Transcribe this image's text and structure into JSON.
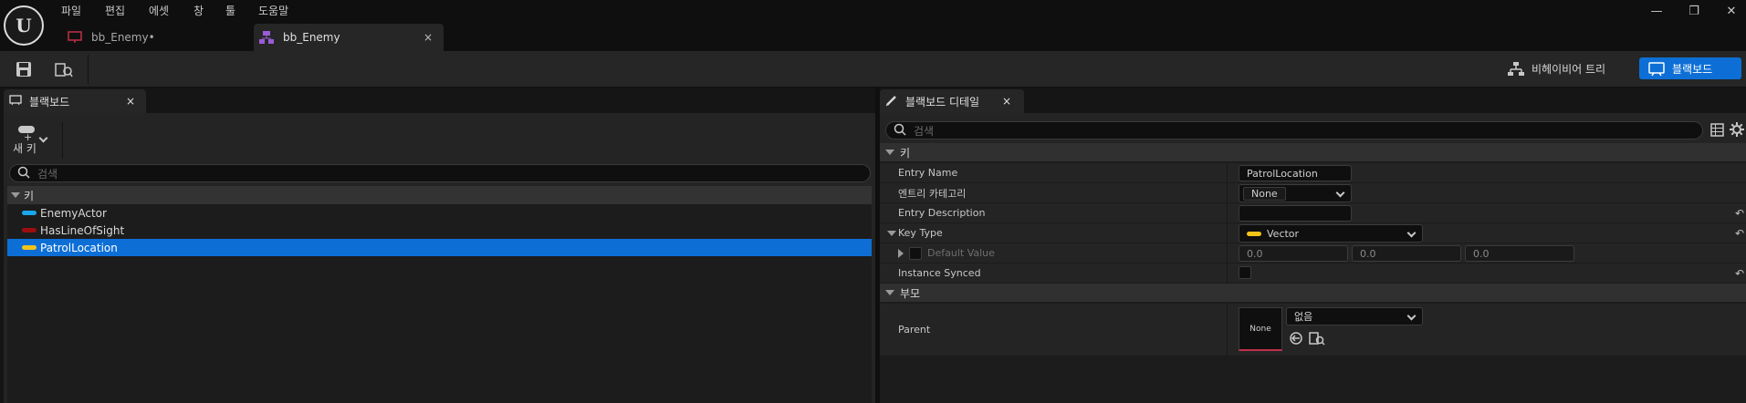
{
  "menu": [
    "파일",
    "편집",
    "에셋",
    "창",
    "툴",
    "도움말"
  ],
  "window_controls": {
    "minimize": "—",
    "restore": "❐",
    "close": "✕"
  },
  "doc_tabs": [
    {
      "label": "bb_Enemy•",
      "icon": "behavior-tree-icon",
      "color": "#c0304a"
    },
    {
      "label": "bb_Enemy",
      "icon": "blackboard-icon",
      "color": "#9a5cd6",
      "close": "×"
    }
  ],
  "toolbar": {
    "save_icon": "save-icon",
    "browse_icon": "browse-icon",
    "behavior_tree_label": "비헤이비어 트리",
    "blackboard_label": "블랙보드"
  },
  "left_panel": {
    "tab_label": "블랙보드",
    "close": "×",
    "new_key_label": "새 키",
    "search_placeholder": "검색",
    "section_label": "키",
    "keys": [
      {
        "name": "EnemyActor",
        "color": "#1aa7ec",
        "selected": false
      },
      {
        "name": "HasLineOfSight",
        "color": "#9c0e0e",
        "selected": false
      },
      {
        "name": "PatrolLocation",
        "color": "#f5c31a",
        "selected": true
      }
    ]
  },
  "right_panel": {
    "tab_label": "블랙보드 디테일",
    "close": "×",
    "search_placeholder": "검색",
    "section_key": "키",
    "section_parent": "부모",
    "entry_name_label": "Entry Name",
    "entry_name_value": "PatrolLocation",
    "entry_category_label": "엔트리 카테고리",
    "entry_category_value": "None",
    "entry_description_label": "Entry Description",
    "entry_description_value": "",
    "key_type_label": "Key Type",
    "key_type_value": "Vector",
    "key_type_color": "#f5c31a",
    "default_value_label": "Default Value",
    "default_values": [
      "0.0",
      "0.0",
      "0.0"
    ],
    "instance_synced_label": "Instance Synced",
    "parent_label": "Parent",
    "parent_thumb_label": "None",
    "parent_value": "없음",
    "reset_glyph": "↶"
  }
}
